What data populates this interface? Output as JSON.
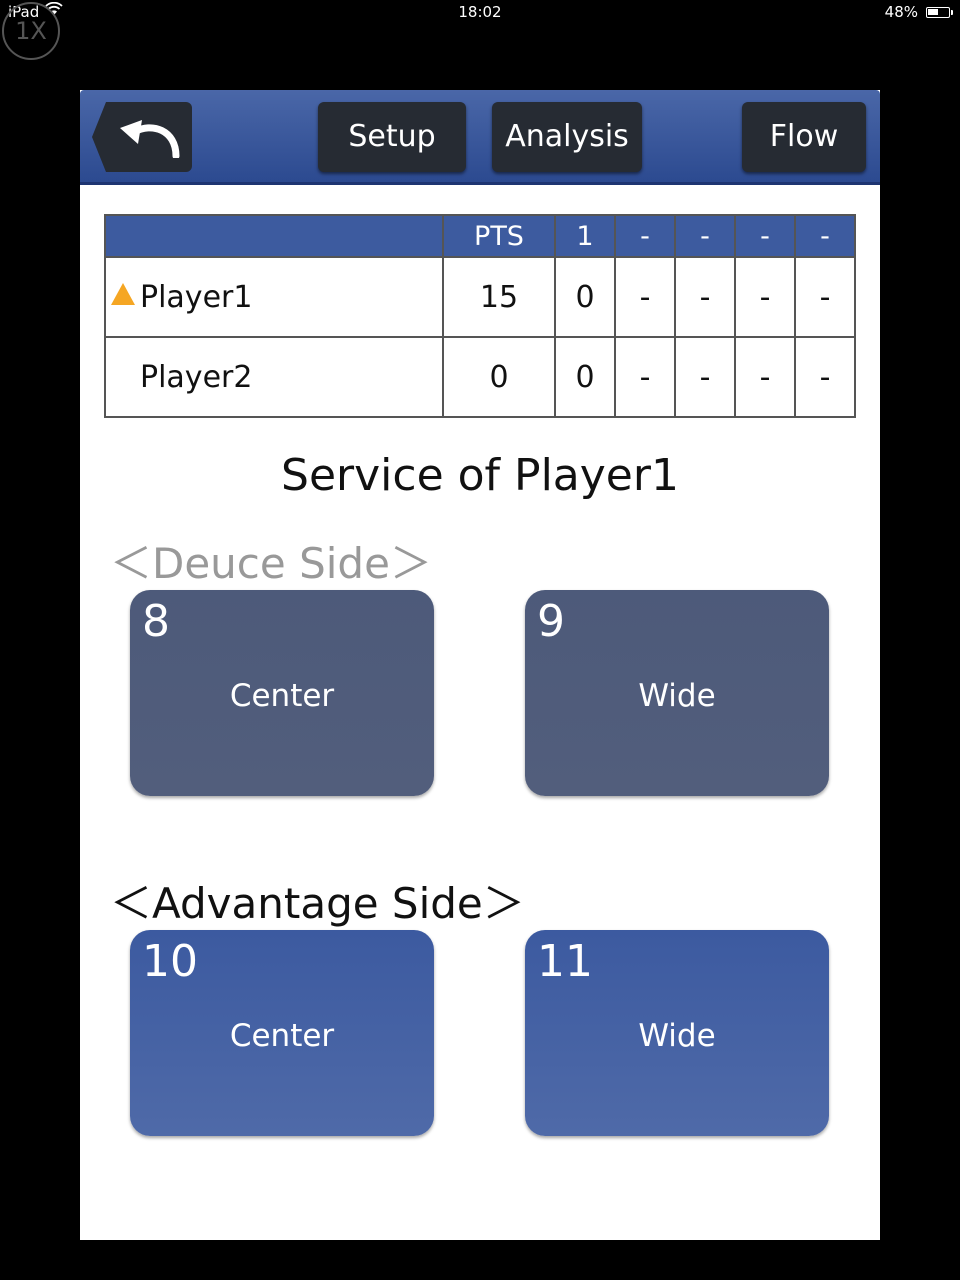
{
  "status_bar": {
    "device": "iPad",
    "time": "18:02",
    "battery_percent": "48%",
    "battery_level": 0.48
  },
  "zoom_badge": "1X",
  "toolbar": {
    "back_icon": "undo-arrow-icon",
    "setup_label": "Setup",
    "analysis_label": "Analysis",
    "flow_label": "Flow"
  },
  "scoreboard": {
    "headers": [
      "",
      "PTS",
      "1",
      "-",
      "-",
      "-",
      "-"
    ],
    "rows": [
      {
        "name": "Player1",
        "serving": true,
        "pts": "15",
        "sets": [
          "0",
          "-",
          "-",
          "-",
          "-"
        ]
      },
      {
        "name": "Player2",
        "serving": false,
        "pts": "0",
        "sets": [
          "0",
          "-",
          "-",
          "-",
          "-"
        ]
      }
    ]
  },
  "service_title": "Service of Player1",
  "deuce_side": {
    "label": "＜Deuce Side＞",
    "buttons": [
      {
        "number": "8",
        "label": "Center"
      },
      {
        "number": "9",
        "label": "Wide"
      }
    ]
  },
  "advantage_side": {
    "label": "＜Advantage Side＞",
    "buttons": [
      {
        "number": "10",
        "label": "Center"
      },
      {
        "number": "11",
        "label": "Wide"
      }
    ]
  },
  "colors": {
    "toolbar": "#3d5b9f",
    "deuce_button": "#4f5b7b",
    "advantage_button": "#4563a5",
    "server_marker": "#f5a623"
  }
}
